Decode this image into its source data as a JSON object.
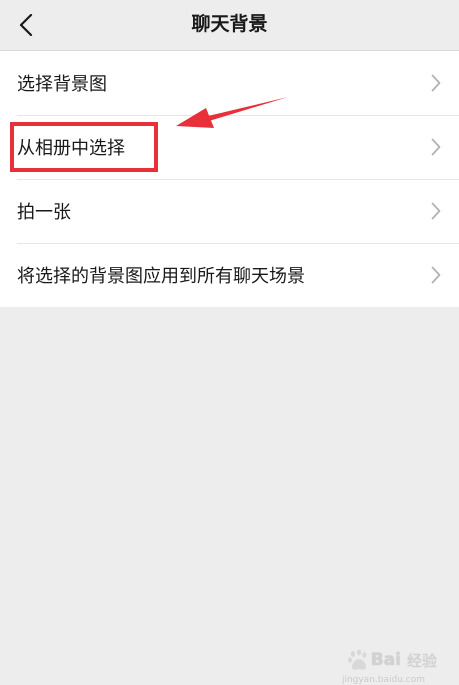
{
  "header": {
    "title": "聊天背景",
    "back_icon": "chevron-left-icon"
  },
  "menu": {
    "items": [
      {
        "label": "选择背景图"
      },
      {
        "label": "从相册中选择"
      },
      {
        "label": "拍一张"
      },
      {
        "label": "将选择的背景图应用到所有聊天场景"
      }
    ]
  },
  "annotation": {
    "color": "#e8303a"
  },
  "watermark": {
    "text": "Bai",
    "suffix": "经验",
    "url": "jingyan.baidu.com"
  }
}
